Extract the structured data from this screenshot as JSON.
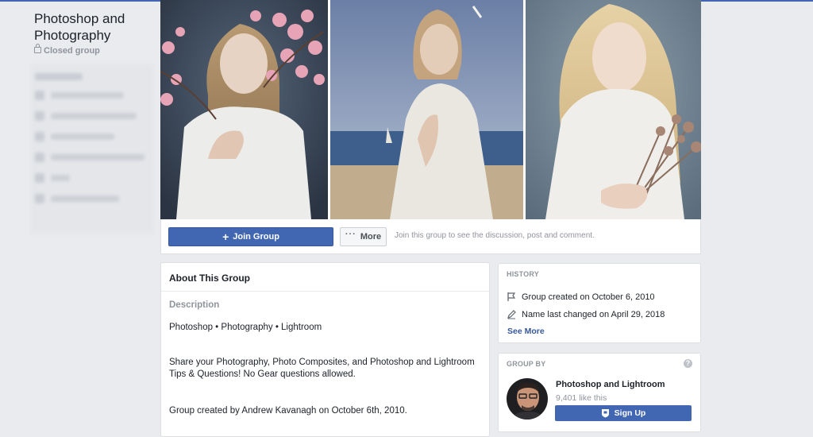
{
  "sidebar": {
    "group_name": "Photoshop and Photography",
    "privacy": "Closed group"
  },
  "cover": {
    "photos": [
      {
        "icon": "cover-photo-girl-with-blossoms"
      },
      {
        "icon": "cover-photo-girl-by-sea"
      },
      {
        "icon": "cover-photo-girl-with-dried-flowers"
      }
    ]
  },
  "actions": {
    "join_label": "Join Group",
    "more_label": "More",
    "hint": "Join this group to see the discussion, post and comment."
  },
  "about": {
    "title": "About This Group",
    "description_label": "Description",
    "paragraphs": [
      "Photoshop • Photography • Lightroom",
      "Share your Photography, Photo Composites, and Photoshop and Lightroom Tips & Questions! No Gear questions allowed.",
      "Group created by Andrew Kavanagh on October 6th, 2010."
    ]
  },
  "history": {
    "label": "HISTORY",
    "items": [
      {
        "icon": "flag-icon",
        "text": "Group created on October 6, 2010"
      },
      {
        "icon": "pencil-icon",
        "text": "Name last changed on April 29, 2018"
      }
    ],
    "see_more": "See More"
  },
  "group_by": {
    "label": "GROUP BY",
    "help": "?",
    "page_name": "Photoshop and Lightroom",
    "likes": "9,401 like this",
    "signup_label": "Sign Up"
  },
  "colors": {
    "accent": "#4267b2",
    "link": "#385898",
    "background": "#e9ebee"
  }
}
